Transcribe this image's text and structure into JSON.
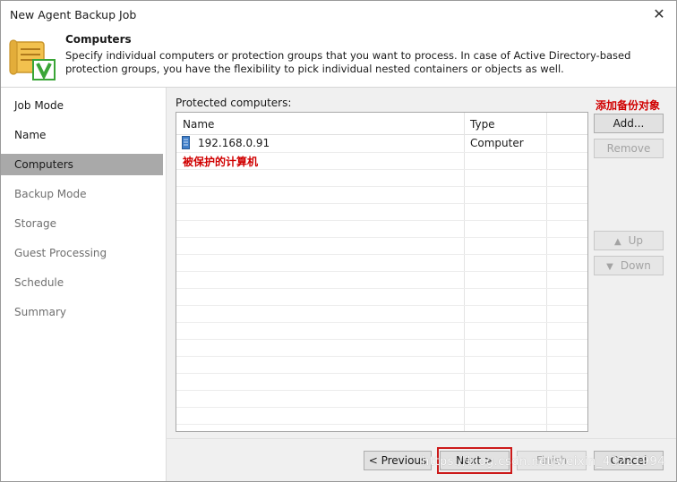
{
  "window": {
    "title": "New Agent Backup Job"
  },
  "header": {
    "title": "Computers",
    "description": "Specify individual computers or protection groups that you want to process. In case of Active Directory-based protection groups, you have the flexibility to pick individual nested containers or objects as well."
  },
  "sidebar": {
    "items": [
      {
        "label": "Job Mode",
        "state": "normal"
      },
      {
        "label": "Name",
        "state": "normal"
      },
      {
        "label": "Computers",
        "state": "active"
      },
      {
        "label": "Backup Mode",
        "state": "disabled"
      },
      {
        "label": "Storage",
        "state": "disabled"
      },
      {
        "label": "Guest Processing",
        "state": "disabled"
      },
      {
        "label": "Schedule",
        "state": "disabled"
      },
      {
        "label": "Summary",
        "state": "disabled"
      }
    ]
  },
  "main": {
    "list_label": "Protected computers:",
    "columns": [
      "Name",
      "Type"
    ],
    "rows": [
      {
        "name": "192.168.0.91",
        "type": "Computer"
      }
    ],
    "annotation_list": "被保护的计算机",
    "annotation_add": "添加备份对象"
  },
  "side_buttons": {
    "add": "Add...",
    "remove": "Remove",
    "up": "Up",
    "down": "Down"
  },
  "footer": {
    "previous": "< Previous",
    "next": "Next >",
    "finish": "Finish",
    "cancel": "Cancel"
  },
  "watermark": "https://blog.csdn.net/weixin_43221994",
  "colors": {
    "active_item": "#a9a9a9",
    "annotation": "#d00000",
    "highlight_box": "#cc1a1a",
    "icon_green": "#3aa537"
  }
}
